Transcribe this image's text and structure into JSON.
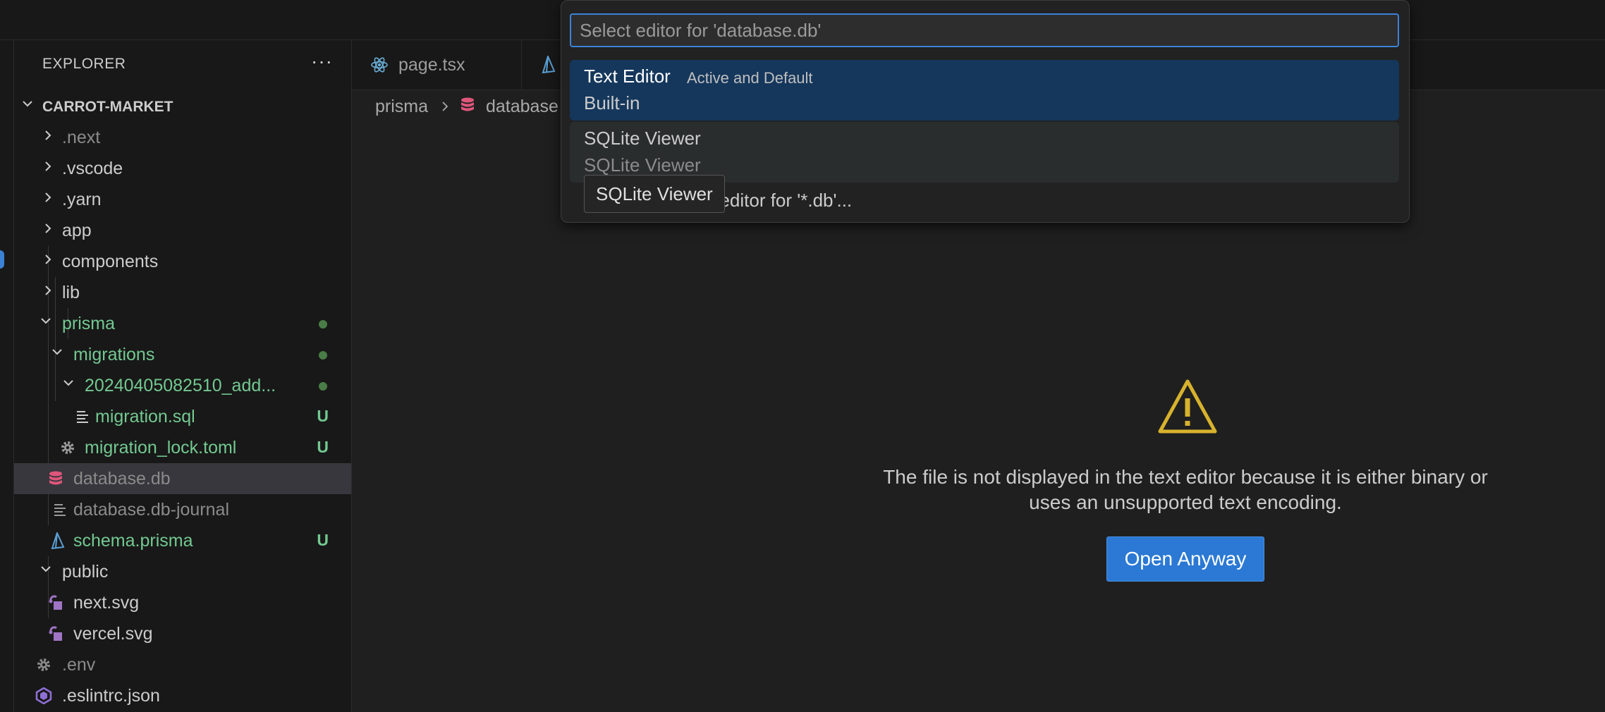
{
  "explorer": {
    "title": "EXPLORER",
    "more_label": "···",
    "root": "CARROT-MARKET",
    "items": [
      {
        "label": ".next",
        "icon": "chevron-right-icon"
      },
      {
        "label": ".vscode",
        "icon": "chevron-right-icon"
      },
      {
        "label": ".yarn",
        "icon": "chevron-right-icon"
      },
      {
        "label": "app",
        "icon": "chevron-right-icon"
      },
      {
        "label": "components",
        "icon": "chevron-right-icon"
      },
      {
        "label": "lib",
        "icon": "chevron-right-icon"
      },
      {
        "label": "prisma",
        "icon": "chevron-down-icon"
      },
      {
        "label": "migrations",
        "icon": "chevron-down-icon"
      },
      {
        "label": "20240405082510_add...",
        "icon": "chevron-down-icon"
      },
      {
        "label": "migration.sql",
        "icon": "text-file-icon",
        "badge": "U"
      },
      {
        "label": "migration_lock.toml",
        "icon": "gear-icon",
        "badge": "U"
      },
      {
        "label": "database.db",
        "icon": "database-icon"
      },
      {
        "label": "database.db-journal",
        "icon": "text-file-icon"
      },
      {
        "label": "schema.prisma",
        "icon": "prisma-icon",
        "badge": "U"
      },
      {
        "label": "public",
        "icon": "chevron-down-icon"
      },
      {
        "label": "next.svg",
        "icon": "svg-file-icon"
      },
      {
        "label": "vercel.svg",
        "icon": "svg-file-icon"
      },
      {
        "label": ".env",
        "icon": "gear-icon"
      },
      {
        "label": ".eslintrc.json",
        "icon": "eslint-icon"
      }
    ]
  },
  "tabs": [
    {
      "label": "page.tsx",
      "icon": "react-icon"
    },
    {
      "label": "",
      "icon": "prisma-icon"
    }
  ],
  "breadcrumb": [
    "prisma",
    "database"
  ],
  "editor": {
    "message": "The file is not displayed in the text editor because it is either binary or uses an unsupported text encoding.",
    "button": "Open Anyway"
  },
  "quick_pick": {
    "placeholder": "Select editor for 'database.db'",
    "items": [
      {
        "name": "Text Editor",
        "description": "Active and Default",
        "detail": "Built-in"
      },
      {
        "name": "SQLite Viewer",
        "description": "",
        "detail": "SQLite Viewer"
      }
    ],
    "configure": "Configure default editor for '*.db'...",
    "configure_visible": "t editor for '*.db'...",
    "tooltip": "SQLite Viewer"
  },
  "colors": {
    "accent": "#3b82d6",
    "untracked": "#73c991",
    "warning": "#d7b22d",
    "database": "#e0567b"
  }
}
